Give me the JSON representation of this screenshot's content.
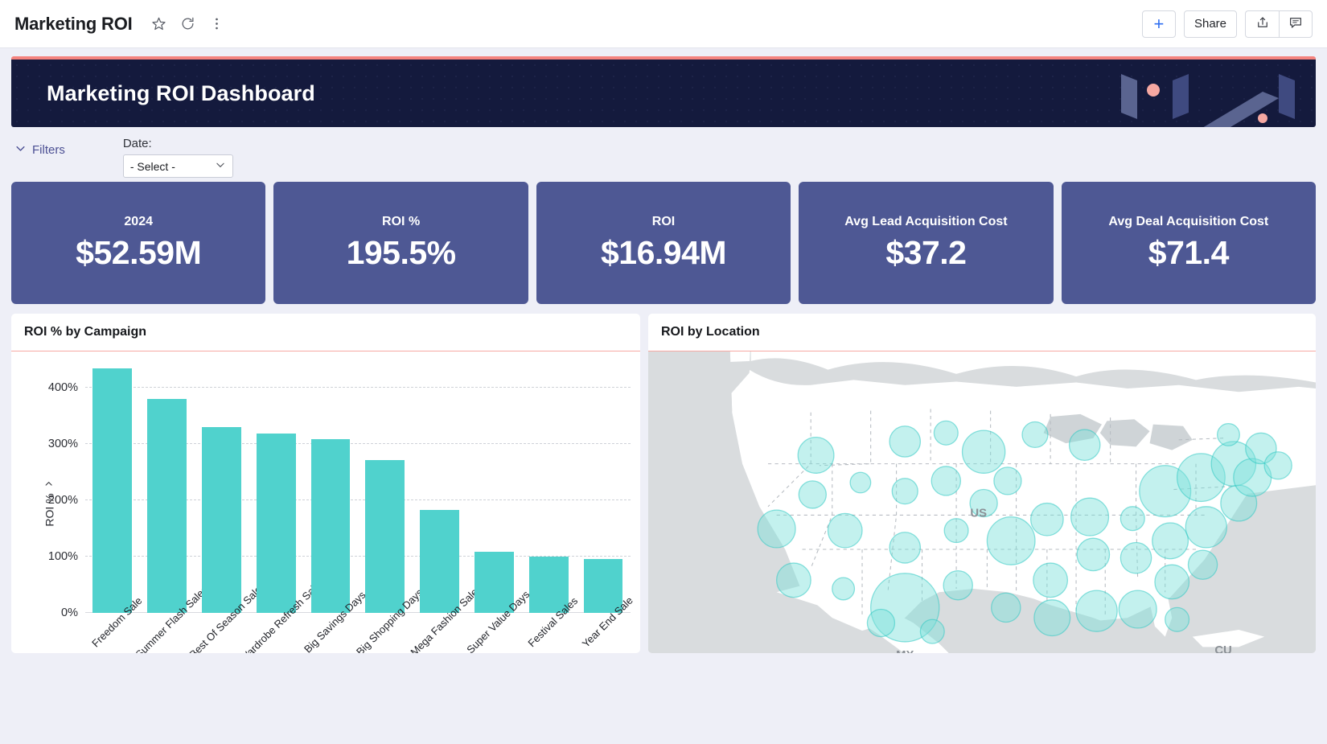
{
  "appbar": {
    "title": "Marketing ROI",
    "icons": [
      {
        "name": "favorite-star-icon",
        "glyph": "☆"
      },
      {
        "name": "refresh-icon",
        "glyph": "⟳"
      },
      {
        "name": "more-options-icon",
        "glyph": "⋮"
      }
    ],
    "add_label": "+",
    "share_label": "Share",
    "export_label": "⬆",
    "comment_label": "🗩"
  },
  "banner": {
    "title": "Marketing ROI Dashboard",
    "bg_color": "#141a3d",
    "accent_color": "#f4837e"
  },
  "filters": {
    "toggle_label": "Filters",
    "date_label": "Date:",
    "date_value": "- Select -",
    "date_placeholder": "- Select -"
  },
  "kpis": [
    {
      "label": "2024",
      "value": "$52.59M"
    },
    {
      "label": "ROI %",
      "value": "195.5%"
    },
    {
      "label": "ROI",
      "value": "$16.94M"
    },
    {
      "label": "Avg Lead Acquisition Cost",
      "value": "$37.2"
    },
    {
      "label": "Avg Deal Acquisition Cost",
      "value": "$71.4"
    }
  ],
  "panels": {
    "bar_title": "ROI % by Campaign",
    "map_title": "ROI by Location"
  },
  "chart_data": [
    {
      "type": "bar",
      "title": "ROI % by Campaign",
      "xlabel": "",
      "ylabel": "ROI %",
      "ylim": [
        0,
        450
      ],
      "yticks": [
        0,
        100,
        200,
        300,
        400
      ],
      "ytick_labels": [
        "0%",
        "100%",
        "200%",
        "300%",
        "400%"
      ],
      "grid": true,
      "legend": "none",
      "bar_color": "#50d2cd",
      "categories": [
        "Freedom Sale",
        "Summer Flash Sales",
        "Best Of Season Sale",
        "Wardrobe Refresh Sale",
        "Big Savings Days",
        "Big Shopping Days",
        "Mega Fashion Sale",
        "Super Value Days",
        "Festival Sales",
        "Year End Sale"
      ],
      "values": [
        434,
        380,
        330,
        318,
        308,
        272,
        183,
        108,
        100,
        96
      ]
    },
    {
      "type": "bubble-map",
      "title": "ROI by Location",
      "region": "United States",
      "country_labels": [
        "US",
        "MX",
        "CU"
      ],
      "bubble_color": "#79dfda",
      "bubble_stroke": "#2fc9c3",
      "ocean_color": "#d9dcde",
      "land_color": "#ffffff",
      "note": "Bubble size encodes ROI per state; largest bubbles in California, Texas and the Northeast corridor."
    }
  ]
}
